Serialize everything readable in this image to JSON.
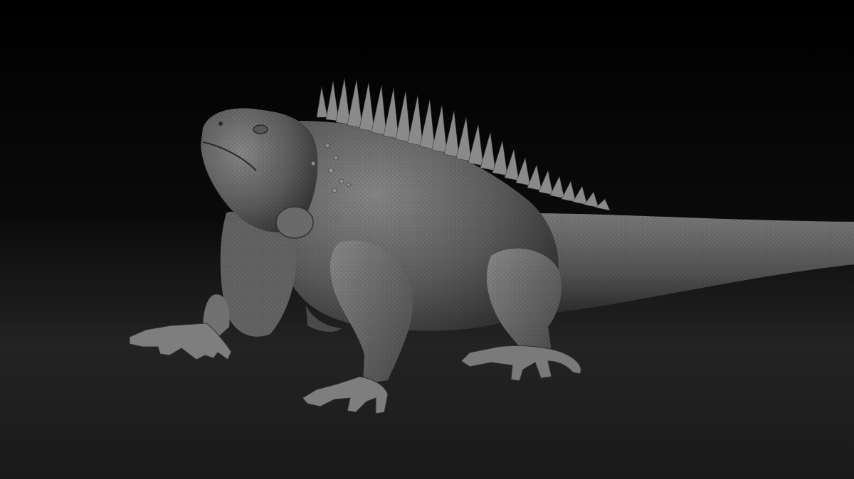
{
  "scene": {
    "subject": "iguana-sculpt",
    "colors": {
      "background_top": "#000000",
      "background_mid": "#232323",
      "background_bottom": "#1a1a1a",
      "clay_light": "#8a8a8a",
      "clay_mid": "#5e5e5e",
      "clay_dark": "#2c2c2c"
    }
  }
}
